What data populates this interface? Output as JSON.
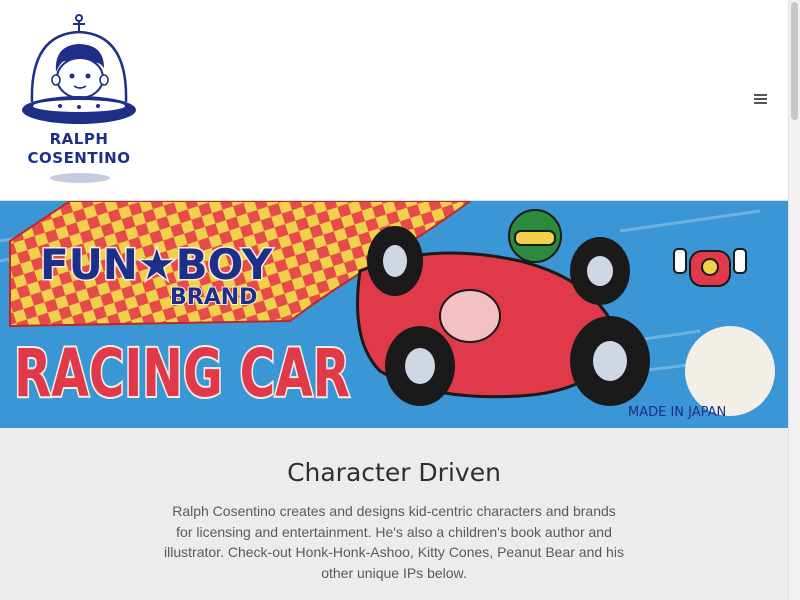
{
  "header": {
    "logo_line1": "RALPH",
    "logo_line2": "COSENTINO",
    "menu_icon": "hamburger-menu-icon"
  },
  "banner": {
    "brand_text": "FUN★BOY",
    "brand_sub": "BRAND",
    "title": "RACING CAR",
    "made_in": "MADE IN JAPAN"
  },
  "main": {
    "heading": "Character Driven",
    "paragraph": "Ralph Cosentino creates and designs kid-centric characters and brands for licensing and entertainment. He's also a children's book author and illustrator. Check-out Honk-Honk-Ashoo, Kitty Cones, Peanut Bear and his other unique IPs below."
  },
  "colors": {
    "brand_blue": "#1d2f86",
    "banner_blue": "#3b96d6",
    "racing_red": "#e03a4a",
    "checker_yellow": "#f2d14a"
  }
}
